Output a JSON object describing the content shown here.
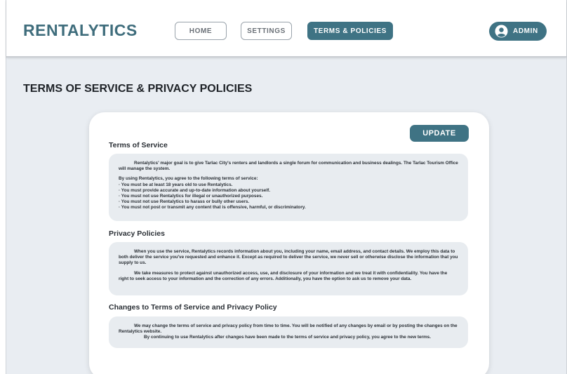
{
  "header": {
    "brand": "RENTALYTICS",
    "nav": [
      {
        "label": "HOME"
      },
      {
        "label": "SETTINGS"
      },
      {
        "label": "TERMS & POLICIES"
      }
    ],
    "admin_label": "ADMIN",
    "accent_color": "#3f7384"
  },
  "page": {
    "title": "TERMS OF SERVICE & PRIVACY POLICIES"
  },
  "card": {
    "update_label": "UPDATE",
    "terms": {
      "heading": "Terms of Service",
      "intro": "Rentalytics' major goal is to give Tarlac City's renters and landlords a single forum for communication and business dealings. The Tarlac Tourism Office will manage the system.",
      "agree": "By using Rentalytics, you agree to the following terms of service:",
      "items": [
        "· You must be at least 18 years old to use Rentalytics.",
        "· You must provide accurate and up-to-date information about yourself.",
        "· You must not use Rentalytics for illegal or unauthorized purposes.",
        "· You must not use Rentalytics to harass or bully other users.",
        "· You must not post or transmit any content that is offensive, harmful, or discriminatory."
      ]
    },
    "privacy": {
      "heading": "Privacy Policies",
      "p1": "When you use the service, Rentalytics records information about you, including your name, email address, and contact details. We employ this data to both deliver the service you've requested and enhance it. Except as required to deliver the service, we never sell or otherwise disclose the information that you supply to us.",
      "p2": "We take measures to protect against unauthorized access, use, and disclosure of your information and we treat it with confidentiality. You have the right to seek access to your information and the correction of any errors. Additionally, you have the option to ask us to remove your data."
    },
    "changes": {
      "heading": "Changes to Terms of Service and Privacy Policy",
      "p1": "We may change the terms of service and privacy policy from time to time. You will be notified of any changes by email or by posting the changes on the Rentalytics website.",
      "p2": "By continuing to use Rentalytics after changes have been made to the terms of service and privacy policy, you agree to the new terms."
    }
  }
}
